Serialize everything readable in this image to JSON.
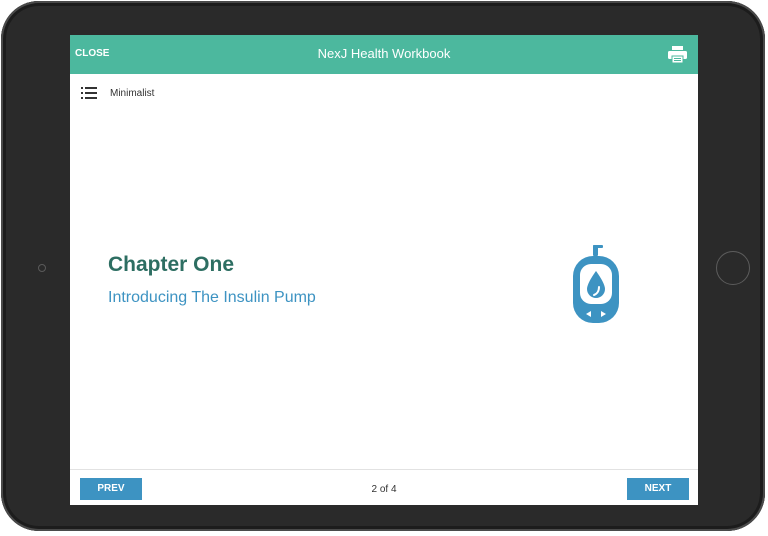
{
  "header": {
    "close_label": "CLOSE",
    "title": "NexJ Health Workbook",
    "print_icon": "printer-icon"
  },
  "toolbar": {
    "menu_icon": "list-icon",
    "view_label": "Minimalist"
  },
  "content": {
    "chapter_title": "Chapter One",
    "chapter_subtitle": "Introducing The Insulin Pump",
    "illustration_icon": "insulin-pump-icon"
  },
  "footer": {
    "prev_label": "PREV",
    "page_indicator": "2 of 4",
    "next_label": "NEXT"
  },
  "colors": {
    "header_bg": "#4cb89e",
    "title_green": "#2d6e62",
    "accent_blue": "#3d93c2",
    "device_bezel": "#2a2a2a"
  }
}
